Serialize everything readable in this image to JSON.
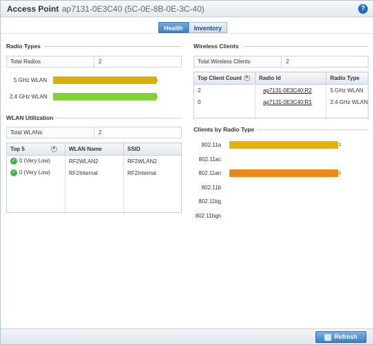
{
  "header": {
    "title": "Access Point",
    "subtitle": "ap7131-0E3C40 (5C-0E-8B-0E-3C-40)",
    "help_icon": "help-icon",
    "help_glyph": "?"
  },
  "tabs": [
    {
      "label": "Health",
      "active": true
    },
    {
      "label": "Inventory",
      "active": false
    }
  ],
  "radio_types": {
    "title": "Radio Types",
    "total_label": "Total Radios",
    "total_value": "2",
    "bars": [
      {
        "label": "5 GHz WLAN",
        "value": 1,
        "end_label": "1",
        "color": "#e0b400"
      },
      {
        "label": "2.4 GHz WLAN",
        "value": 1,
        "end_label": "1",
        "color": "#86d632"
      }
    ]
  },
  "wlan_utilization": {
    "title": "WLAN Utilization",
    "total_label": "Total WLANs",
    "total_value": "2",
    "columns": [
      "Top 5",
      "WLAN Name",
      "SSID"
    ],
    "rows": [
      {
        "top5": "0 (Very Low)",
        "wlan_name": "RF2WLAN2",
        "ssid": "RF2WLAN2"
      },
      {
        "top5": "0 (Very Low)",
        "wlan_name": "RF2Internal",
        "ssid": "RF2Internal"
      }
    ]
  },
  "wireless_clients": {
    "title": "Wireless Clients",
    "total_label": "Total Wireless Clients",
    "total_value": "2",
    "columns": [
      "Top Client Count",
      "Radio Id",
      "Radio Type"
    ],
    "rows": [
      {
        "count": "2",
        "radio_id": "ap7131-0E3C40:R2",
        "radio_type": "5 GHz WLAN"
      },
      {
        "count": "0",
        "radio_id": "ap7131-0E3C40:R1",
        "radio_type": "2.4 GHz WLAN"
      }
    ]
  },
  "clients_by_radio": {
    "title": "Clients by Radio Type"
  },
  "chart_data": {
    "type": "bar",
    "orientation": "horizontal",
    "categories": [
      "802.11a",
      "802.11ac",
      "802.11an",
      "802.11b",
      "802.11bg",
      "802.11bgn"
    ],
    "values": [
      1,
      0,
      1,
      0,
      0,
      0
    ],
    "end_labels": [
      "1",
      "",
      "1",
      "",
      "",
      ""
    ],
    "colors": [
      "#e0b400",
      "",
      "#e8891a",
      "",
      "",
      ""
    ],
    "xlim": [
      0,
      1
    ]
  },
  "footer": {
    "refresh_label": "Refresh"
  }
}
